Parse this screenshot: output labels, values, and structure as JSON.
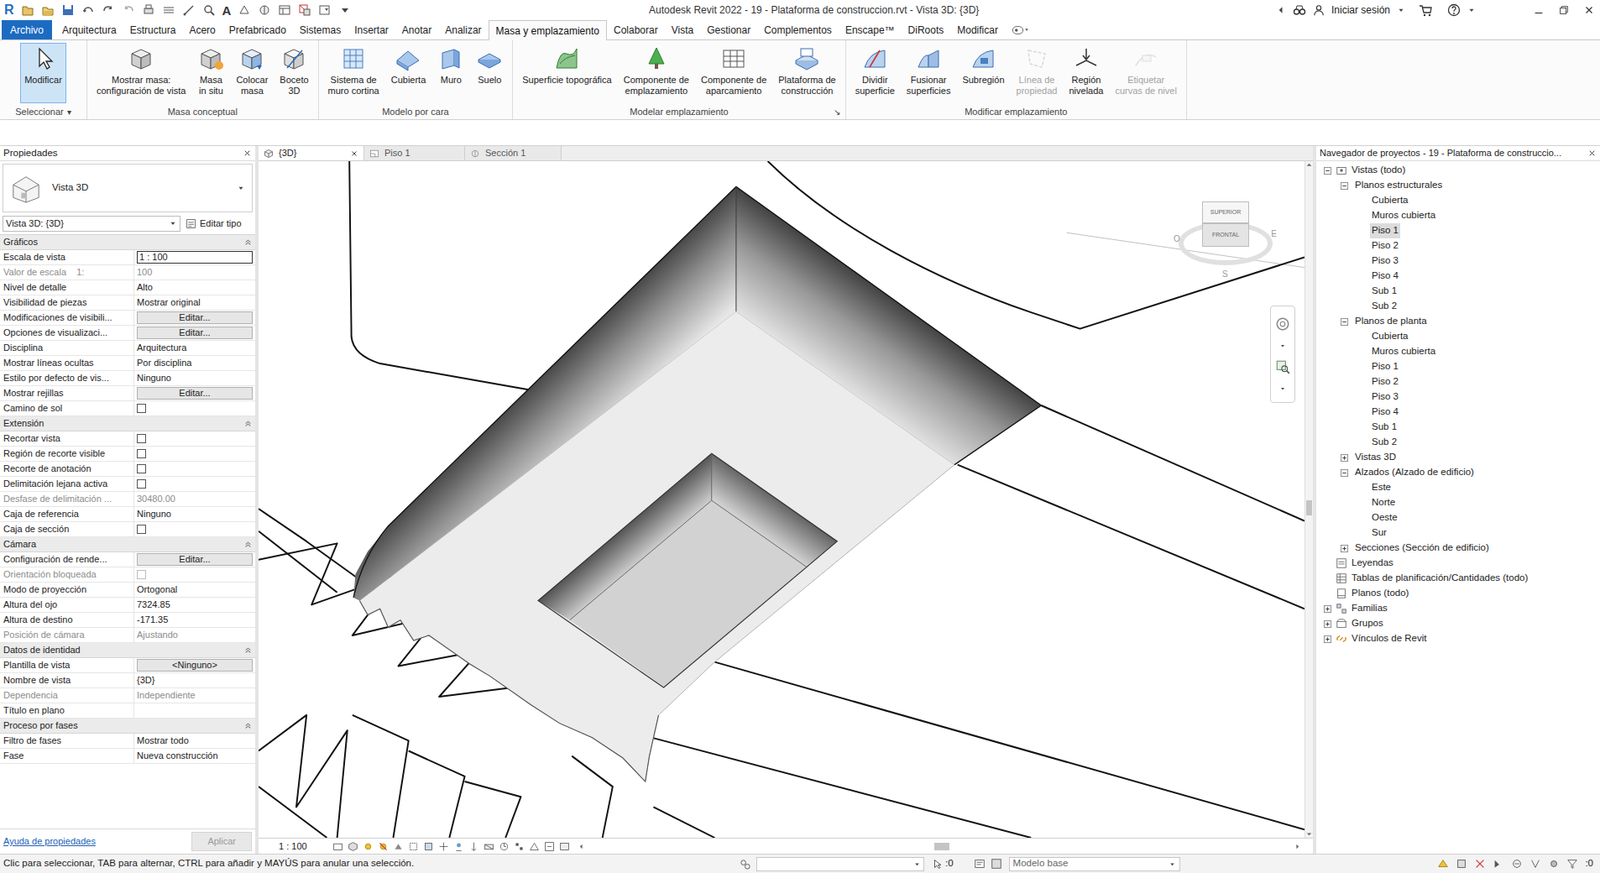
{
  "title_bar": {
    "logo": "R",
    "text_tool": "A",
    "title": "Autodesk Revit 2022 - 19 - Plataforma de construccion.rvt - Vista 3D: {3D}",
    "signin": "Iniciar sesión"
  },
  "ribbon_tabs": [
    {
      "label": "Archivo",
      "kind": "file",
      "selected": false
    },
    {
      "label": "Arquitectura",
      "kind": "tab",
      "selected": false
    },
    {
      "label": "Estructura",
      "kind": "tab",
      "selected": false
    },
    {
      "label": "Acero",
      "kind": "tab",
      "selected": false
    },
    {
      "label": "Prefabricado",
      "kind": "tab",
      "selected": false
    },
    {
      "label": "Sistemas",
      "kind": "tab",
      "selected": false
    },
    {
      "label": "Insertar",
      "kind": "tab",
      "selected": false
    },
    {
      "label": "Anotar",
      "kind": "tab",
      "selected": false
    },
    {
      "label": "Analizar",
      "kind": "tab",
      "selected": false
    },
    {
      "label": "Masa y emplazamiento",
      "kind": "tab",
      "selected": true
    },
    {
      "label": "Colaborar",
      "kind": "tab",
      "selected": false
    },
    {
      "label": "Vista",
      "kind": "tab",
      "selected": false
    },
    {
      "label": "Gestionar",
      "kind": "tab",
      "selected": false
    },
    {
      "label": "Complementos",
      "kind": "tab",
      "selected": false
    },
    {
      "label": "Enscape™",
      "kind": "tab",
      "selected": false
    },
    {
      "label": "DiRoots",
      "kind": "tab",
      "selected": false
    },
    {
      "label": "Modificar",
      "kind": "tab",
      "selected": false
    }
  ],
  "ribbon_panels": [
    {
      "title": "Seleccionar",
      "dropdown": "▾",
      "buttons": [
        {
          "lines": [
            "Modificar"
          ],
          "selected": true,
          "disabled": false
        }
      ]
    },
    {
      "title": "Masa conceptual",
      "buttons": [
        {
          "lines": [
            "Mostrar masa:",
            "configuración de vista"
          ],
          "selected": false,
          "disabled": false
        },
        {
          "lines": [
            "Masa",
            "in situ"
          ],
          "selected": false,
          "disabled": false
        },
        {
          "lines": [
            "Colocar",
            "masa"
          ],
          "selected": false,
          "disabled": false
        },
        {
          "lines": [
            "Boceto",
            "3D"
          ],
          "selected": false,
          "disabled": false
        }
      ]
    },
    {
      "title": "Modelo por cara",
      "buttons": [
        {
          "lines": [
            "Sistema de",
            "muro cortina"
          ],
          "selected": false,
          "disabled": false
        },
        {
          "lines": [
            "Cubierta"
          ],
          "selected": false,
          "disabled": false
        },
        {
          "lines": [
            "Muro"
          ],
          "selected": false,
          "disabled": false
        },
        {
          "lines": [
            "Suelo"
          ],
          "selected": false,
          "disabled": false
        }
      ]
    },
    {
      "title": "Modelar emplazamiento",
      "launcher": "↘",
      "buttons": [
        {
          "lines": [
            "Superficie topográfica"
          ],
          "selected": false,
          "disabled": false
        },
        {
          "lines": [
            "Componente de",
            "emplazamiento"
          ],
          "selected": false,
          "disabled": false
        },
        {
          "lines": [
            "Componente de",
            "aparcamiento"
          ],
          "selected": false,
          "disabled": false
        },
        {
          "lines": [
            "Plataforma de",
            "construcción"
          ],
          "selected": false,
          "disabled": false
        }
      ]
    },
    {
      "title": "Modificar emplazamiento",
      "buttons": [
        {
          "lines": [
            "Dividir",
            "superficie"
          ],
          "selected": false,
          "disabled": false
        },
        {
          "lines": [
            "Fusionar",
            "superficies"
          ],
          "selected": false,
          "disabled": false
        },
        {
          "lines": [
            "Subregión"
          ],
          "selected": false,
          "disabled": false
        },
        {
          "lines": [
            "Línea de",
            "propiedad"
          ],
          "selected": false,
          "disabled": true
        },
        {
          "lines": [
            "Región",
            "nivelada"
          ],
          "selected": false,
          "disabled": false
        },
        {
          "lines": [
            "Etiquetar",
            "curvas de nivel"
          ],
          "selected": false,
          "disabled": true
        }
      ]
    }
  ],
  "properties": {
    "title": "Propiedades",
    "type_name": "Vista 3D",
    "instance": "Vista 3D: {3D}",
    "edit_type": "Editar tipo",
    "groups": [
      {
        "title": "Gráficos",
        "expanded": true,
        "rows": [
          {
            "label": "Escala de vista",
            "value": "1 : 100",
            "kind": "input",
            "disabled": false
          },
          {
            "label": "Valor de escala    1:",
            "value": "100",
            "kind": "text",
            "disabled": true
          },
          {
            "label": "Nivel de detalle",
            "value": "Alto",
            "kind": "text",
            "disabled": false
          },
          {
            "label": "Visibilidad de piezas",
            "value": "Mostrar original",
            "kind": "text",
            "disabled": false
          },
          {
            "label": "Modificaciones de visibili...",
            "value": "Editar...",
            "kind": "button",
            "disabled": false
          },
          {
            "label": "Opciones de visualizaci...",
            "value": "Editar...",
            "kind": "button",
            "disabled": false
          },
          {
            "label": "Disciplina",
            "value": "Arquitectura",
            "kind": "text",
            "disabled": false
          },
          {
            "label": "Mostrar líneas ocultas",
            "value": "Por disciplina",
            "kind": "text",
            "disabled": false
          },
          {
            "label": "Estilo por defecto de vis...",
            "value": "Ninguno",
            "kind": "text",
            "disabled": false
          },
          {
            "label": "Mostrar rejillas",
            "value": "Editar...",
            "kind": "button",
            "disabled": false
          },
          {
            "label": "Camino de sol",
            "kind": "checkbox",
            "checked": false,
            "disabled": false
          }
        ]
      },
      {
        "title": "Extensión",
        "expanded": true,
        "rows": [
          {
            "label": "Recortar vista",
            "kind": "checkbox",
            "checked": false,
            "disabled": false
          },
          {
            "label": "Región de recorte visible",
            "kind": "checkbox",
            "checked": false,
            "disabled": false
          },
          {
            "label": "Recorte de anotación",
            "kind": "checkbox",
            "checked": false,
            "disabled": false
          },
          {
            "label": "Delimitación lejana activa",
            "kind": "checkbox",
            "checked": false,
            "disabled": false
          },
          {
            "label": "Desfase de delimitación ...",
            "value": "30480.00",
            "kind": "text",
            "disabled": true
          },
          {
            "label": "Caja de referencia",
            "value": "Ninguno",
            "kind": "text",
            "disabled": false
          },
          {
            "label": "Caja de sección",
            "kind": "checkbox",
            "checked": false,
            "disabled": false
          }
        ]
      },
      {
        "title": "Cámara",
        "expanded": true,
        "rows": [
          {
            "label": "Configuración de rende...",
            "value": "Editar...",
            "kind": "button",
            "disabled": false
          },
          {
            "label": "Orientación bloqueada",
            "kind": "checkbox",
            "checked": false,
            "disabled": true
          },
          {
            "label": "Modo de proyección",
            "value": "Ortogonal",
            "kind": "text",
            "disabled": false
          },
          {
            "label": "Altura del ojo",
            "value": "7324.85",
            "kind": "text",
            "disabled": false
          },
          {
            "label": "Altura de destino",
            "value": "-171.35",
            "kind": "text",
            "disabled": false
          },
          {
            "label": "Posición de cámara",
            "value": "Ajustando",
            "kind": "text",
            "disabled": true
          }
        ]
      },
      {
        "title": "Datos de identidad",
        "expanded": true,
        "rows": [
          {
            "label": "Plantilla de vista",
            "value": "<Ninguno>",
            "kind": "button",
            "disabled": false
          },
          {
            "label": "Nombre de vista",
            "value": "{3D}",
            "kind": "text",
            "disabled": false
          },
          {
            "label": "Dependencia",
            "value": "Independiente",
            "kind": "text",
            "disabled": true
          },
          {
            "label": "Título en plano",
            "value": "",
            "kind": "text",
            "disabled": false
          }
        ]
      },
      {
        "title": "Proceso por fases",
        "expanded": true,
        "rows": [
          {
            "label": "Filtro de fases",
            "value": "Mostrar todo",
            "kind": "text",
            "disabled": false
          },
          {
            "label": "Fase",
            "value": "Nueva construcción",
            "kind": "text",
            "disabled": false
          }
        ]
      }
    ],
    "help": "Ayuda de propiedades",
    "apply": {
      "label": "Aplicar",
      "disabled": true
    }
  },
  "view_tabs": [
    {
      "label": "{3D}",
      "selected": true
    },
    {
      "label": "Piso 1",
      "selected": false
    },
    {
      "label": "Sección 1",
      "selected": false
    }
  ],
  "viewport": {
    "viewcube": {
      "top": "SUPERIOR",
      "front": "FRONTAL",
      "left": "O",
      "right": "E",
      "bottom": "S"
    },
    "scale": "1 : 100"
  },
  "project_browser": {
    "title": "Navegador de proyectos - 19 - Plataforma de construccio...",
    "tree": [
      {
        "label": "Vistas (todo)",
        "level": 0,
        "kind": "branch",
        "expanded": true,
        "selected": false
      },
      {
        "label": "Planos estructurales",
        "level": 1,
        "kind": "branch",
        "expanded": true,
        "selected": false
      },
      {
        "label": "Cubierta",
        "level": 2,
        "kind": "leaf",
        "expanded": false,
        "selected": false
      },
      {
        "label": "Muros cubierta",
        "level": 2,
        "kind": "leaf",
        "expanded": false,
        "selected": false
      },
      {
        "label": "Piso 1",
        "level": 2,
        "kind": "leaf",
        "expanded": false,
        "selected": true
      },
      {
        "label": "Piso 2",
        "level": 2,
        "kind": "leaf",
        "expanded": false,
        "selected": false
      },
      {
        "label": "Piso 3",
        "level": 2,
        "kind": "leaf",
        "expanded": false,
        "selected": false
      },
      {
        "label": "Piso 4",
        "level": 2,
        "kind": "leaf",
        "expanded": false,
        "selected": false
      },
      {
        "label": "Sub 1",
        "level": 2,
        "kind": "leaf",
        "expanded": false,
        "selected": false
      },
      {
        "label": "Sub 2",
        "level": 2,
        "kind": "leaf",
        "expanded": false,
        "selected": false
      },
      {
        "label": "Planos de planta",
        "level": 1,
        "kind": "branch",
        "expanded": true,
        "selected": false
      },
      {
        "label": "Cubierta",
        "level": 2,
        "kind": "leaf",
        "expanded": false,
        "selected": false
      },
      {
        "label": "Muros cubierta",
        "level": 2,
        "kind": "leaf",
        "expanded": false,
        "selected": false
      },
      {
        "label": "Piso 1",
        "level": 2,
        "kind": "leaf",
        "expanded": false,
        "selected": false
      },
      {
        "label": "Piso 2",
        "level": 2,
        "kind": "leaf",
        "expanded": false,
        "selected": false
      },
      {
        "label": "Piso 3",
        "level": 2,
        "kind": "leaf",
        "expanded": false,
        "selected": false
      },
      {
        "label": "Piso 4",
        "level": 2,
        "kind": "leaf",
        "expanded": false,
        "selected": false
      },
      {
        "label": "Sub 1",
        "level": 2,
        "kind": "leaf",
        "expanded": false,
        "selected": false
      },
      {
        "label": "Sub 2",
        "level": 2,
        "kind": "leaf",
        "expanded": false,
        "selected": false
      },
      {
        "label": "Vistas 3D",
        "level": 1,
        "kind": "branch",
        "expanded": false,
        "selected": false
      },
      {
        "label": "Alzados (Alzado de edificio)",
        "level": 1,
        "kind": "branch",
        "expanded": true,
        "selected": false
      },
      {
        "label": "Este",
        "level": 2,
        "kind": "leaf",
        "expanded": false,
        "selected": false
      },
      {
        "label": "Norte",
        "level": 2,
        "kind": "leaf",
        "expanded": false,
        "selected": false
      },
      {
        "label": "Oeste",
        "level": 2,
        "kind": "leaf",
        "expanded": false,
        "selected": false
      },
      {
        "label": "Sur",
        "level": 2,
        "kind": "leaf",
        "expanded": false,
        "selected": false
      },
      {
        "label": "Secciones (Sección de edificio)",
        "level": 1,
        "kind": "branch",
        "expanded": false,
        "selected": false
      },
      {
        "label": "Leyendas",
        "level": 0,
        "kind": "leaf",
        "expanded": false,
        "selected": false
      },
      {
        "label": "Tablas de planificación/Cantidades (todo)",
        "level": 0,
        "kind": "leaf",
        "expanded": false,
        "selected": false
      },
      {
        "label": "Planos (todo)",
        "level": 0,
        "kind": "leaf",
        "expanded": false,
        "selected": false
      },
      {
        "label": "Familias",
        "level": 0,
        "kind": "branch",
        "expanded": false,
        "selected": false
      },
      {
        "label": "Grupos",
        "level": 0,
        "kind": "branch",
        "expanded": false,
        "selected": false
      },
      {
        "label": "Vínculos de Revit",
        "level": 0,
        "kind": "branch",
        "expanded": false,
        "selected": false
      }
    ]
  },
  "status_bar": {
    "message": "Clic para seleccionar, TAB para alternar, CTRL para añadir y MAYÚS para anular una selección.",
    "selection_count": ":0",
    "workset": "Modelo base",
    "filter_count": ":0"
  }
}
